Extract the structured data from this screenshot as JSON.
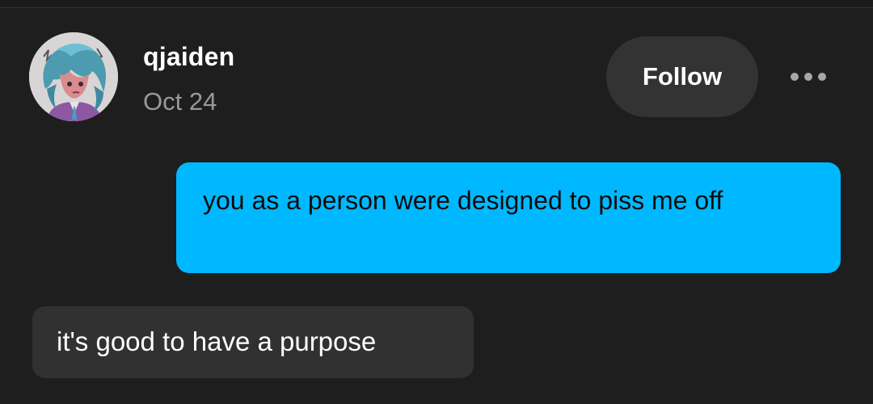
{
  "post": {
    "username": "qjaiden",
    "date": "Oct 24",
    "follow_label": "Follow",
    "more_icon": "ellipsis-icon",
    "avatar_icon": "avatar-image"
  },
  "chat": {
    "messages": [
      {
        "side": "sent",
        "text": "you as a person were designed to piss me off"
      },
      {
        "side": "received",
        "text": "it's good to have a purpose"
      }
    ]
  },
  "colors": {
    "background": "#1f1e1f",
    "sent_bubble": "#00b8ff",
    "received_bubble": "#323132",
    "follow_button": "#343334",
    "date_text": "#9a999a"
  }
}
